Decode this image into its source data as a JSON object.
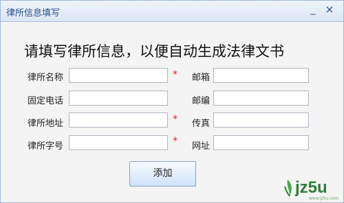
{
  "window": {
    "title": "律所信息填写",
    "minimize_symbol": "_",
    "close_symbol": "×"
  },
  "form": {
    "heading": "请填写律所信息，以便自动生成法律文书",
    "fields": {
      "firm_name": {
        "label": "律所名称",
        "value": "",
        "required_mark": "*"
      },
      "phone": {
        "label": "固定电话",
        "value": ""
      },
      "address": {
        "label": "律所地址",
        "value": "",
        "required_mark": "*"
      },
      "license_no": {
        "label": "律所字号",
        "value": "",
        "required_mark": "*"
      },
      "mailbox": {
        "label": "邮箱",
        "value": ""
      },
      "postcode": {
        "label": "邮编",
        "value": ""
      },
      "fax": {
        "label": "传真",
        "value": "",
        "required_mark": "*"
      },
      "website": {
        "label": "网址",
        "value": ""
      }
    },
    "submit_label": "添加"
  },
  "watermark": {
    "text": "jz5u",
    "small_text": "www.jz5u.com"
  },
  "colors": {
    "accent": "#2b4f86",
    "required": "#e31919",
    "watermark": "#2f7d3b"
  }
}
